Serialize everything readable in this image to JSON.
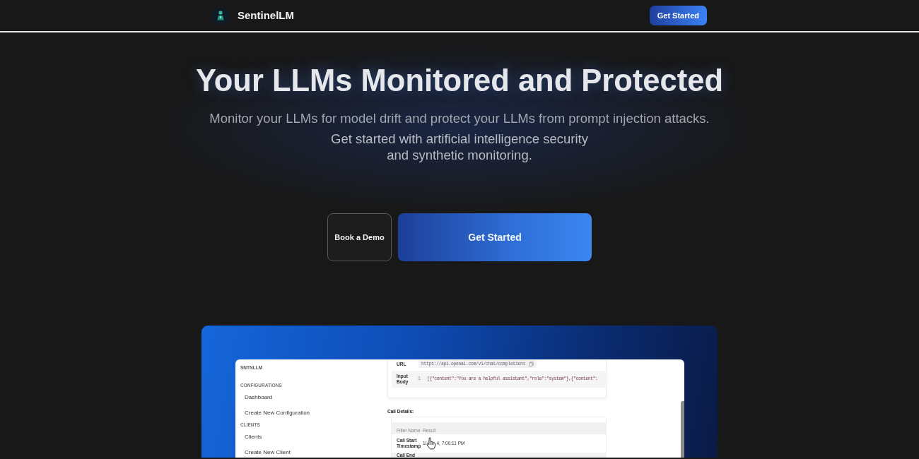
{
  "navbar": {
    "brand": "SentinelLM",
    "cta": "Get Started"
  },
  "hero": {
    "title": "Your LLMs Monitored and Protected",
    "subtitle": "Monitor your LLMs for model drift and protect your LLMs from prompt injection attacks.",
    "tagline": "Get started with artificial intelligence security and synthetic monitoring.",
    "buttons": [
      {
        "label": "Book a Demo",
        "kind": "outline"
      },
      {
        "label": "Get Started",
        "kind": "primary"
      }
    ]
  },
  "preview": {
    "sidebar": {
      "brand": "SNTNLLM",
      "sections": [
        {
          "heading": "CONFIGURATIONS",
          "items": [
            "Dashboard",
            "Create New Configuration"
          ]
        },
        {
          "heading": "CLIENTS",
          "items": [
            "Clients",
            "Create New Client"
          ]
        }
      ]
    },
    "request": {
      "rows": [
        {
          "label": "URL",
          "kind": "url",
          "value": "https://api.openai.com/v1/chat/completions"
        },
        {
          "label": "Input Body",
          "kind": "code",
          "line_number": "1",
          "value": "[{\"content\":\"You are a helpful assistant\",\"role\":\"system\"},{\"content\":"
        }
      ]
    },
    "call_details": {
      "title": "Call Details:",
      "columns": [
        "Filter Name",
        "Result"
      ],
      "rows": [
        {
          "name": "Call Start Timestamp",
          "result_parts": [
            "1/",
            "4, 7:00:11 PM"
          ]
        },
        {
          "name": "Call End"
        }
      ]
    }
  }
}
